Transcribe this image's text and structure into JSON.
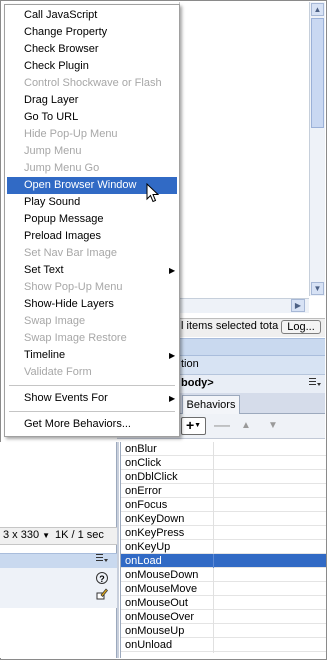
{
  "menu": {
    "items": [
      {
        "label": "Call JavaScript",
        "enabled": true
      },
      {
        "label": "Change Property",
        "enabled": true
      },
      {
        "label": "Check Browser",
        "enabled": true
      },
      {
        "label": "Check Plugin",
        "enabled": true
      },
      {
        "label": "Control Shockwave or Flash",
        "enabled": false
      },
      {
        "label": "Drag Layer",
        "enabled": true
      },
      {
        "label": "Go To URL",
        "enabled": true
      },
      {
        "label": "Hide Pop-Up Menu",
        "enabled": false
      },
      {
        "label": "Jump Menu",
        "enabled": false
      },
      {
        "label": "Jump Menu Go",
        "enabled": false
      },
      {
        "label": "Open Browser Window",
        "enabled": true,
        "highlighted": true
      },
      {
        "label": "Play Sound",
        "enabled": true
      },
      {
        "label": "Popup Message",
        "enabled": true
      },
      {
        "label": "Preload Images",
        "enabled": true
      },
      {
        "label": "Set Nav Bar Image",
        "enabled": false
      },
      {
        "label": "Set Text",
        "enabled": true,
        "submenu": true
      },
      {
        "label": "Show Pop-Up Menu",
        "enabled": false
      },
      {
        "label": "Show-Hide Layers",
        "enabled": true
      },
      {
        "label": "Swap Image",
        "enabled": false
      },
      {
        "label": "Swap Image Restore",
        "enabled": false
      },
      {
        "label": "Timeline",
        "enabled": true,
        "submenu": true
      },
      {
        "label": "Validate Form",
        "enabled": false
      }
    ],
    "show_events_for": "Show Events For",
    "get_more_behaviors": "Get More Behaviors..."
  },
  "results_panel": {
    "status_text": "l items selected tota",
    "log_button": "Log..."
  },
  "tag_inspector": {
    "title_fragment": "tion",
    "tag_label": "body>",
    "tabs": {
      "behaviors": "Behaviors"
    }
  },
  "behaviors_panel": {
    "add_button": "+",
    "events": [
      "onBlur",
      "onClick",
      "onDblClick",
      "onError",
      "onFocus",
      "onKeyDown",
      "onKeyPress",
      "onKeyUp",
      "onLoad",
      "onMouseDown",
      "onMouseMove",
      "onMouseOut",
      "onMouseOver",
      "onMouseUp",
      "onUnload"
    ],
    "selected_event": "onLoad"
  },
  "document_status": {
    "window_size": "3 x 330",
    "download_size": "1K / 1 sec"
  },
  "icons": {
    "help": "help-icon",
    "edit": "edit-icon",
    "options": "options-menu-icon",
    "cursor": "mouse-pointer-icon"
  },
  "colors": {
    "selection": "#316ac5",
    "panel_band": "#c9d9ef"
  }
}
